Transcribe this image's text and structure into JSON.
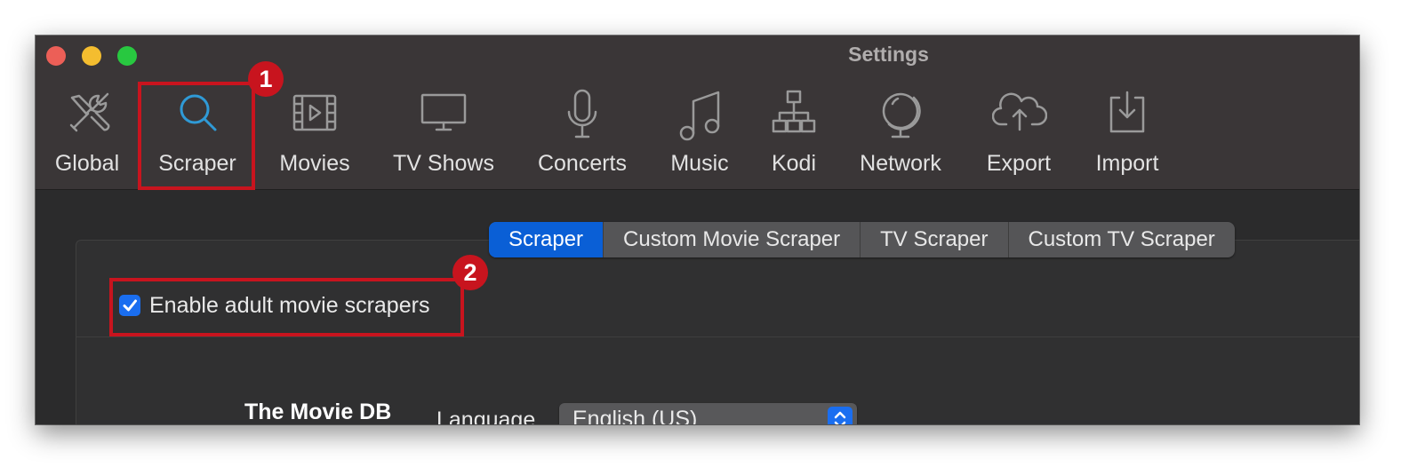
{
  "window": {
    "title": "Settings",
    "traffic_lights": {
      "close": "#ec5f57",
      "minimize": "#f4bd2f",
      "maximize": "#28c840"
    }
  },
  "toolbar": {
    "items": [
      {
        "label": "Global",
        "icon": "tools-icon"
      },
      {
        "label": "Scraper",
        "icon": "search-icon",
        "selected": true
      },
      {
        "label": "Movies",
        "icon": "film-icon"
      },
      {
        "label": "TV Shows",
        "icon": "monitor-icon"
      },
      {
        "label": "Concerts",
        "icon": "microphone-icon"
      },
      {
        "label": "Music",
        "icon": "music-note-icon"
      },
      {
        "label": "Kodi",
        "icon": "network-tree-icon"
      },
      {
        "label": "Network",
        "icon": "globe-icon"
      },
      {
        "label": "Export",
        "icon": "cloud-upload-icon"
      },
      {
        "label": "Import",
        "icon": "download-tray-icon"
      }
    ]
  },
  "tabs": [
    {
      "label": "Scraper",
      "active": true
    },
    {
      "label": "Custom Movie Scraper",
      "active": false
    },
    {
      "label": "TV Scraper",
      "active": false
    },
    {
      "label": "Custom TV Scraper",
      "active": false
    }
  ],
  "adult_checkbox": {
    "label": "Enable adult movie scrapers",
    "checked": true
  },
  "tmdb": {
    "title": "The Movie DB",
    "language_label": "Language",
    "language_value": "English (US)"
  },
  "annotations": [
    {
      "number": "1",
      "target": "Scraper toolbar item"
    },
    {
      "number": "2",
      "target": "Enable adult movie scrapers checkbox"
    }
  ],
  "colors": {
    "accent": "#1a6ef0",
    "tab_active": "#0a5fd6",
    "annotation": "#c8141e",
    "selected_icon": "#2f9ad6"
  }
}
